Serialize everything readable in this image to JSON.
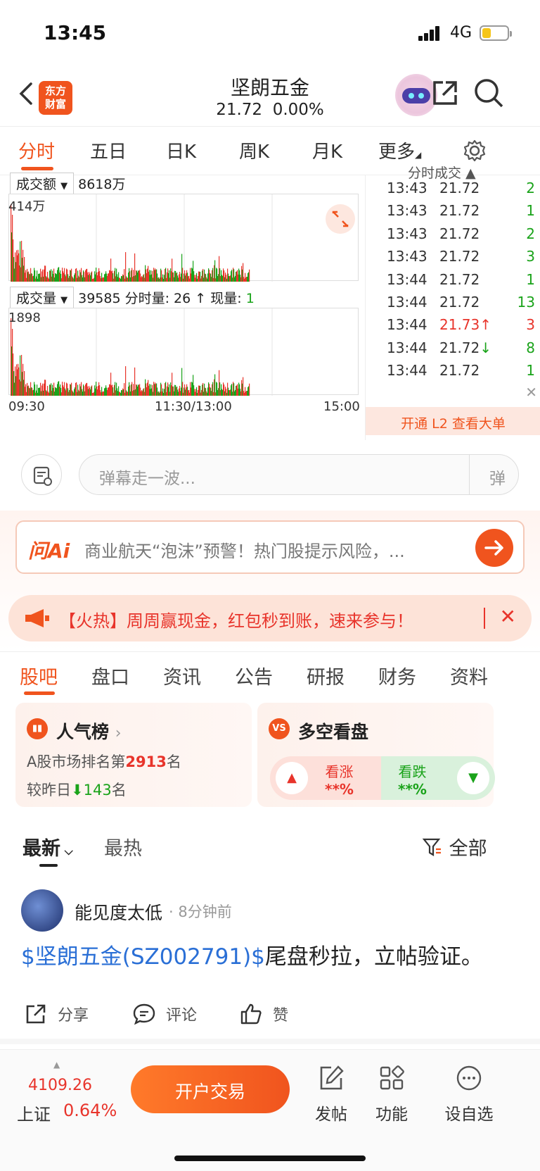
{
  "status": {
    "time": "13:45",
    "network": "4G"
  },
  "header": {
    "logo_line1": "东方",
    "logo_line2": "财富",
    "title": "坚朗五金",
    "price": "21.72",
    "change": "0.00%"
  },
  "chart_tabs": [
    "分时",
    "五日",
    "日K",
    "周K",
    "月K",
    "更多"
  ],
  "chart": {
    "amount_label": "成交额",
    "amount_value": "8618万",
    "amount_max": "414万",
    "volume_label": "成交量",
    "volume_value": "39585",
    "volume_info_prefix": "分时量: 26 ↑ 现量:",
    "volume_now": "1",
    "volume_max": "1898",
    "time_start": "09:30",
    "time_mid": "11:30/13:00",
    "time_end": "15:00"
  },
  "ticks": {
    "header": "分时成交",
    "rows": [
      {
        "time": "13:43",
        "price": "21.72",
        "vol": "2"
      },
      {
        "time": "13:43",
        "price": "21.72",
        "vol": "1"
      },
      {
        "time": "13:43",
        "price": "21.72",
        "vol": "2"
      },
      {
        "time": "13:43",
        "price": "21.72",
        "vol": "3"
      },
      {
        "time": "13:44",
        "price": "21.72",
        "vol": "1"
      },
      {
        "time": "13:44",
        "price": "21.72",
        "vol": "13"
      },
      {
        "time": "13:44",
        "price": "21.73↑",
        "vol": "3"
      },
      {
        "time": "13:44",
        "price": "21.72↓",
        "vol": "8"
      },
      {
        "time": "13:44",
        "price": "21.72",
        "vol": "1"
      }
    ],
    "l2_text": "开通 L2 查看大单"
  },
  "danmu": {
    "placeholder": "弹幕走一波...",
    "button": "弹"
  },
  "ai": {
    "logo": "问Ai",
    "text": "商业航天“泡沫”预警！热门股提示风险，..."
  },
  "hot": {
    "text": "【火热】周周赢现金，红包秒到账，速来参与！"
  },
  "section_tabs": [
    "股吧",
    "盘口",
    "资讯",
    "公告",
    "研报",
    "财务",
    "资料"
  ],
  "popularity": {
    "title": "人气榜",
    "rank_prefix": "A股市场排名第",
    "rank": "2913",
    "rank_suffix": "名",
    "change_prefix": "较昨日",
    "change": "143",
    "change_suffix": "名"
  },
  "sentiment": {
    "title": "多空看盘",
    "up_label": "看涨",
    "up_value": "**%",
    "down_label": "看跌",
    "down_value": "**%"
  },
  "feed": {
    "latest": "最新",
    "hottest": "最热",
    "filter": "全部"
  },
  "post": {
    "user": "能见度太低",
    "time": "8分钟前",
    "tag": "$坚朗五金(SZ002791)$",
    "text": "尾盘秒拉，立帖验证。",
    "share": "分享",
    "comment": "评论",
    "like": "赞"
  },
  "bottom": {
    "index_value": "4109.26",
    "index_name": "上证",
    "index_change": "0.64%",
    "trade": "开户交易",
    "post": "发帖",
    "functions": "功能",
    "watch": "设自选"
  },
  "colors": {
    "accent": "#f0541e",
    "up": "#e8342b",
    "down": "#1aa31a"
  }
}
